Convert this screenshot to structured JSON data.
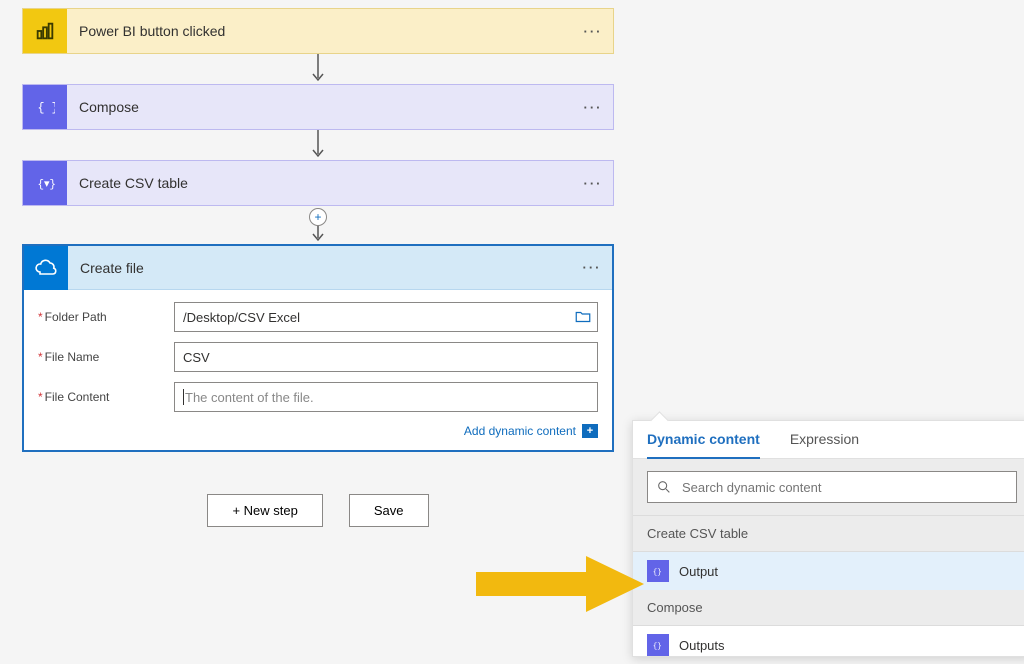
{
  "trigger": {
    "title": "Power BI button clicked"
  },
  "compose": {
    "title": "Compose"
  },
  "csvtable": {
    "title": "Create CSV table"
  },
  "createfile": {
    "title": "Create file",
    "fields": {
      "folder": {
        "label": "Folder Path",
        "value": "/Desktop/CSV Excel"
      },
      "name": {
        "label": "File Name",
        "value": "CSV"
      },
      "content": {
        "label": "File Content",
        "placeholder": "The content of the file."
      }
    },
    "dynlink": "Add dynamic content"
  },
  "buttons": {
    "newstep": "+ New step",
    "save": "Save"
  },
  "dynamic": {
    "tabs": {
      "content": "Dynamic content",
      "expression": "Expression"
    },
    "search_placeholder": "Search dynamic content",
    "groups": {
      "csv": {
        "header": "Create CSV table",
        "item": "Output"
      },
      "compose": {
        "header": "Compose",
        "item": "Outputs"
      }
    }
  }
}
